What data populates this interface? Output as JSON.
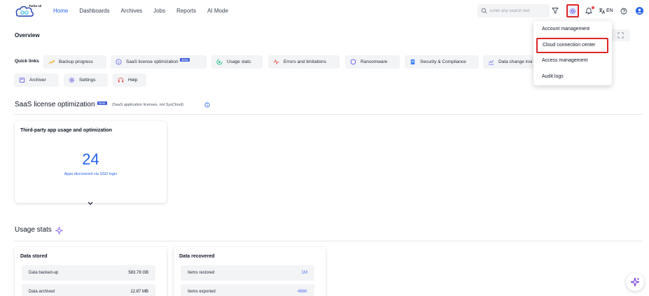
{
  "app": {
    "logo_text": "Turbo UI"
  },
  "nav": {
    "items": [
      "Home",
      "Dashboards",
      "Archives",
      "Jobs",
      "Reports",
      "AI Mode"
    ],
    "active": "Home"
  },
  "header": {
    "search_placeholder": "Enter any search text",
    "language": "EN"
  },
  "overview": {
    "title": "Overview"
  },
  "quick_links": {
    "label": "Quick links",
    "items": [
      {
        "label": "Backup progress",
        "icon": "trend-icon"
      },
      {
        "label": "SaaS license optimization",
        "icon": "license-icon",
        "badge": "Beta"
      },
      {
        "label": "Usage stats",
        "icon": "usage-icon"
      },
      {
        "label": "Errors and limitations",
        "icon": "pulse-icon"
      },
      {
        "label": "Ransomware",
        "icon": "shield-icon"
      },
      {
        "label": "Security & Compliance",
        "icon": "document-icon"
      },
      {
        "label": "Data change insi",
        "icon": "data-change-icon"
      },
      {
        "label": "Archiver",
        "icon": "archive-icon"
      },
      {
        "label": "Settings",
        "icon": "gear-icon"
      },
      {
        "label": "Help",
        "icon": "headset-icon"
      }
    ]
  },
  "saas_section": {
    "title": "SaaS license optimization",
    "badge": "Beta",
    "subtitle": "(SaaS application licenses, not SysCloud)"
  },
  "third_party_card": {
    "title": "Third-party app usage and optimization",
    "value": "24",
    "caption": "Apps discovered via SSO login"
  },
  "usage_section": {
    "title": "Usage stats"
  },
  "data_stored": {
    "title": "Data stored",
    "rows": [
      {
        "label": "Data backed-up",
        "value": "583.78 GB"
      },
      {
        "label": "Data archived",
        "value": "12.87 MB"
      }
    ]
  },
  "data_recovered": {
    "title": "Data recovered",
    "rows": [
      {
        "label": "Items restored",
        "value": "1M"
      },
      {
        "label": "Items exported",
        "value": "466K"
      }
    ]
  },
  "settings_menu": {
    "items": [
      "Account management",
      "Cloud connection center",
      "Access management",
      "Audit logs"
    ],
    "highlighted": "Cloud connection center"
  },
  "colors": {
    "accent": "#2563eb",
    "highlight_border": "#dc2626",
    "beta": "#3b5bdb"
  }
}
